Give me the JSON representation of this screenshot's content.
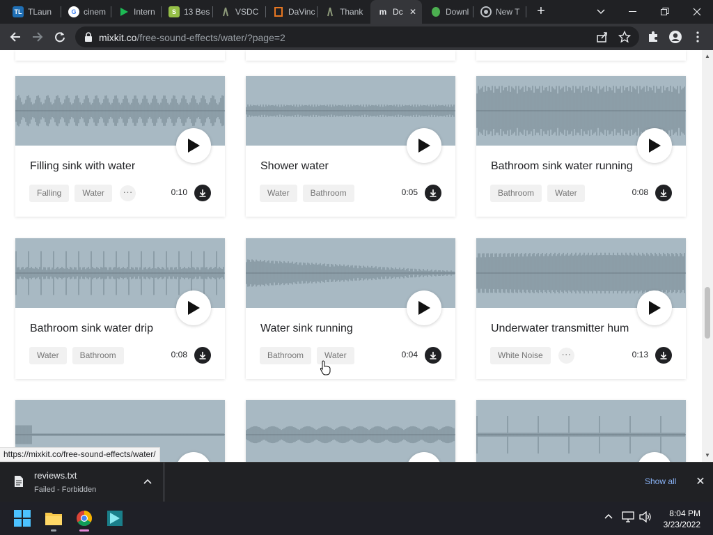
{
  "browser": {
    "tabs": [
      {
        "label": "TLaun",
        "icon": "tl-icon"
      },
      {
        "label": "cinem",
        "icon": "google-icon"
      },
      {
        "label": "Intern",
        "icon": "flag-icon"
      },
      {
        "label": "13 Bes",
        "icon": "shopify-icon"
      },
      {
        "label": "VSDC",
        "icon": "vsdc-icon"
      },
      {
        "label": "DaVinc",
        "icon": "davinci-icon"
      },
      {
        "label": "Thank",
        "icon": "vsdc-icon"
      },
      {
        "label": "Dc",
        "icon": "mixkit-icon",
        "active": true
      },
      {
        "label": "Downl",
        "icon": "leaf-icon"
      },
      {
        "label": "New T",
        "icon": "chrome-icon"
      }
    ],
    "url_host": "mixkit.co",
    "url_path": "/free-sound-effects/water/?page=2",
    "status_url": "https://mixkit.co/free-sound-effects/water/"
  },
  "cards": [
    {
      "title": "Filling sink with water",
      "tags": [
        "Falling",
        "Water"
      ],
      "more": true,
      "duration": "0:10"
    },
    {
      "title": "Shower water",
      "tags": [
        "Water",
        "Bathroom"
      ],
      "more": false,
      "duration": "0:05"
    },
    {
      "title": "Bathroom sink water running",
      "tags": [
        "Bathroom",
        "Water"
      ],
      "more": false,
      "duration": "0:08"
    },
    {
      "title": "Bathroom sink water drip",
      "tags": [
        "Water",
        "Bathroom"
      ],
      "more": false,
      "duration": "0:08"
    },
    {
      "title": "Water sink running",
      "tags": [
        "Bathroom",
        "Water"
      ],
      "more": false,
      "duration": "0:04"
    },
    {
      "title": "Underwater transmitter hum",
      "tags": [
        "White Noise"
      ],
      "more": true,
      "duration": "0:13"
    }
  ],
  "download": {
    "filename": "reviews.txt",
    "status": "Failed - Forbidden",
    "show_all": "Show all"
  },
  "taskbar": {
    "time": "8:04 PM",
    "date": "3/23/2022"
  },
  "colors": {
    "waveform_bg": "#a8b9c3",
    "waveform_line": "#6b7c86",
    "link_blue": "#8ab4f8"
  }
}
